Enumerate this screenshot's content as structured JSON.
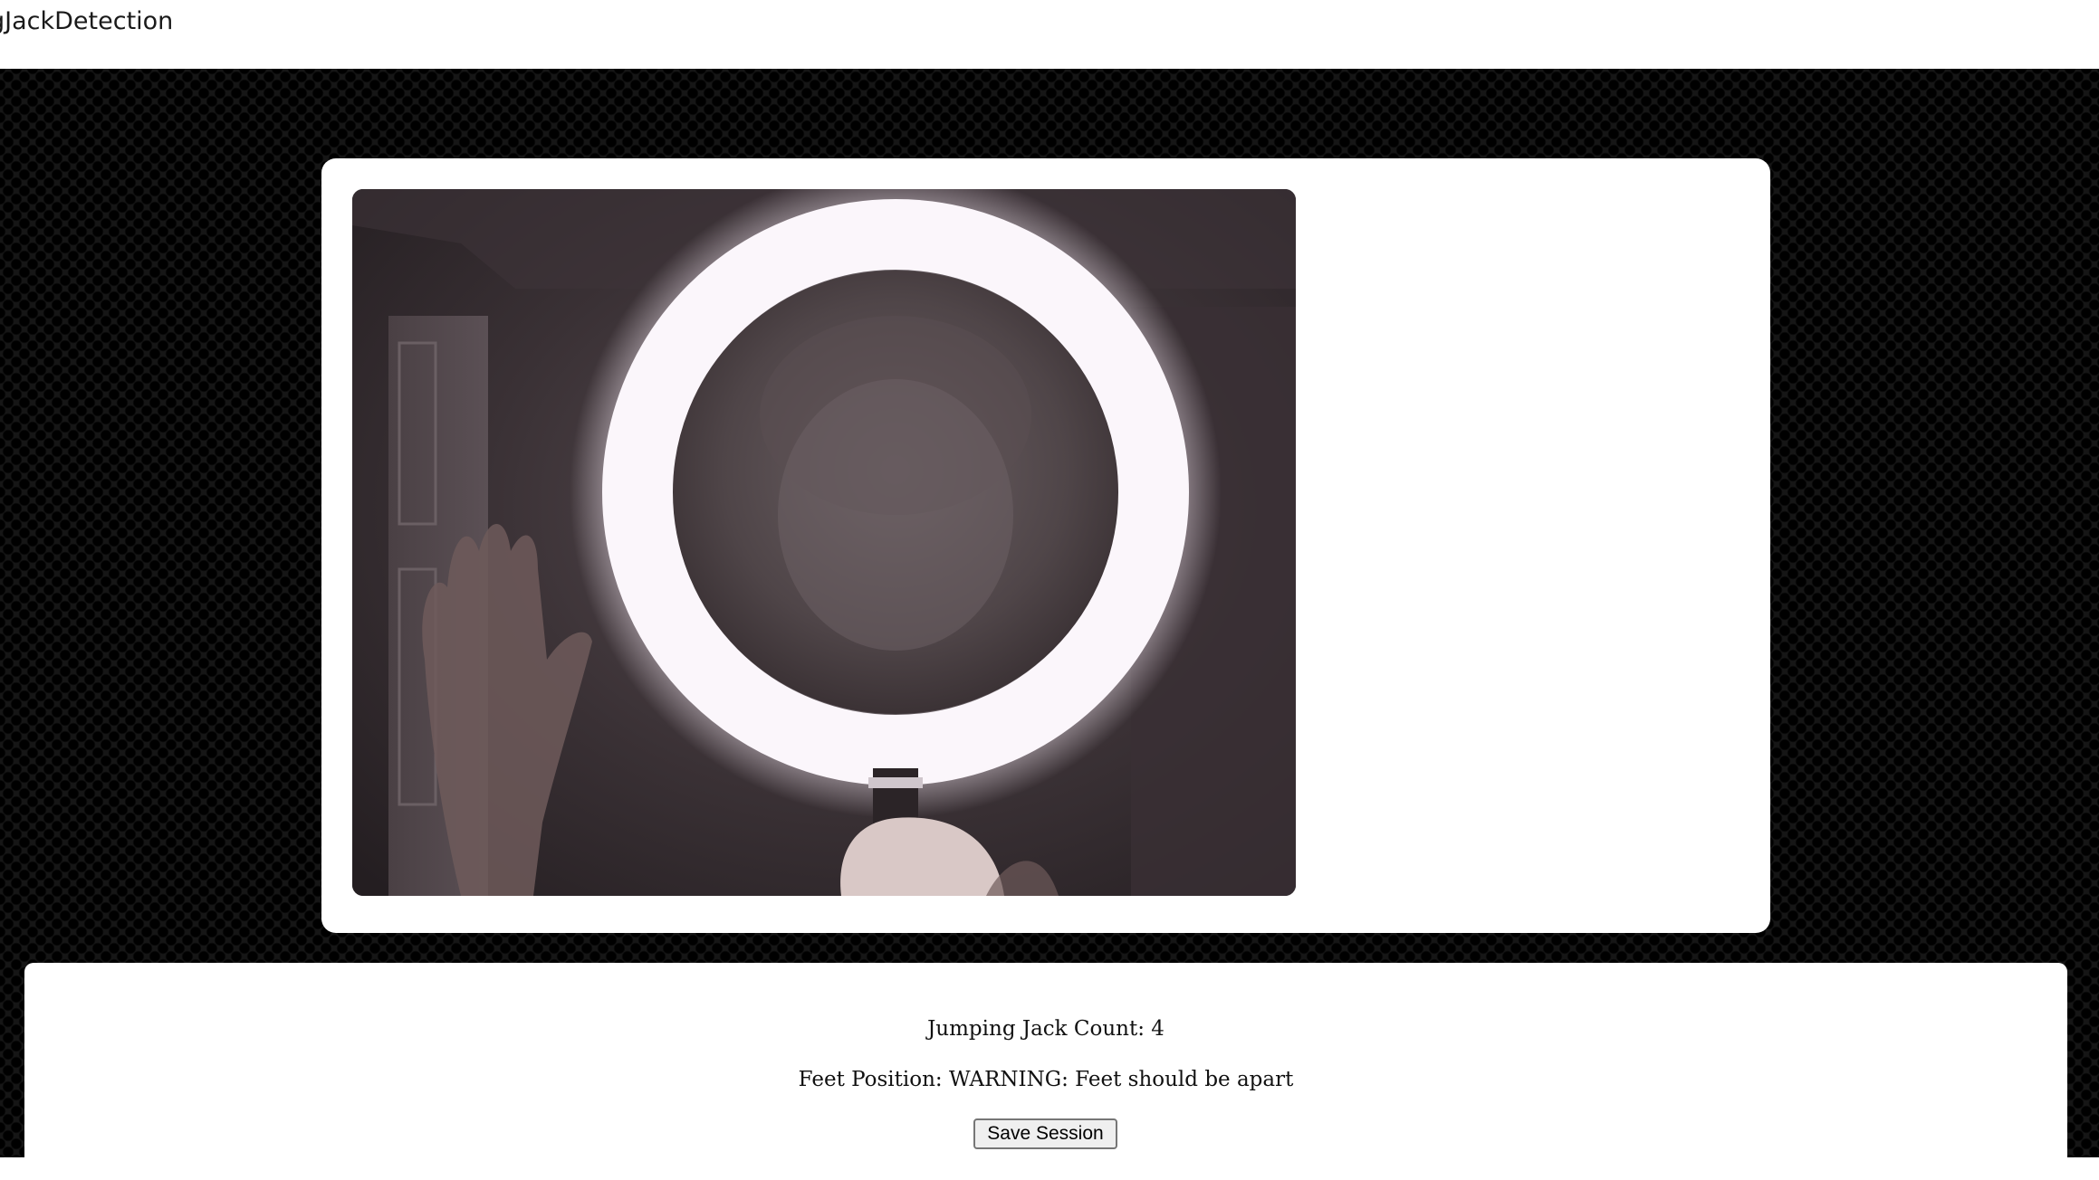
{
  "app": {
    "title": "gJackDetection"
  },
  "video": {
    "label": "webcam-feed"
  },
  "stats": {
    "count_text": "Jumping Jack Count: 4",
    "feet_text": "Feet Position: WARNING: Feet should be apart"
  },
  "actions": {
    "save_label": "Save Session"
  },
  "colors": {
    "background": "#161616",
    "card": "#ffffff",
    "ring_light": "#fbf6fb"
  }
}
